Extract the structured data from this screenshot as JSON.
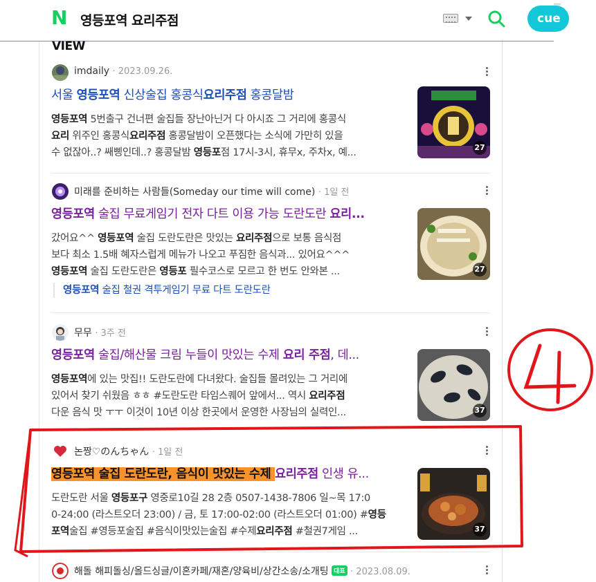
{
  "header": {
    "logo": "N",
    "query": "영등포역 요리주점",
    "cue_label": "cue"
  },
  "section_title": "VIEW",
  "posts": [
    {
      "author": "imdaily",
      "date": "2023.09.26.",
      "title_parts": [
        "서울 ",
        "영등포역",
        " 신상술집 홍콩식",
        "요리주점",
        " 홍콩달밤"
      ],
      "body_lines": [
        [
          "",
          "영등포역",
          " 5번출구 건너편 술집들 장난아닌거 다 아시죠 그 거리에 홍콩식"
        ],
        [
          "",
          "요리",
          " 위주인 홍콩식",
          "요리주점",
          " 홍콩달밤이 오픈했다는 소식에 가만히 있을"
        ],
        [
          "수 없잖아..? 쌔삥인데..? 홍콩달밤 ",
          "영등포",
          "점 17시-3시, 휴무x, 주차x, 예..."
        ]
      ],
      "thumb_count": "27"
    },
    {
      "author": "미래를 준비하는 사람들(Someday our time will come)",
      "date": "1일 전",
      "title_parts": [
        "",
        "영등포역",
        " 술집 무료게임기 전자 다트 이용 가능 도란도란 ",
        "요리..."
      ],
      "body_lines": [
        [
          "갔어요^^ ",
          "영등포역",
          " 술집 도란도란은 맛있는 ",
          "요리주점",
          "으로 보통 음식점"
        ],
        [
          "보다 최소 1.5배 혜자스럽게 메뉴가 나오고 푸짐한 음식과... 있어요^^^"
        ],
        [
          "",
          "영등포역",
          " 술집 도란도란은 ",
          "영등포",
          " 필수코스로 모르고 한 번도 안와본 ..."
        ]
      ],
      "sublink_parts": [
        "영등포역",
        " 술집 철권 격투게임기 무료 다트 도란도란"
      ],
      "thumb_count": "27"
    },
    {
      "author": "무무",
      "date": "3주 전",
      "title_parts": [
        "",
        "영등포역",
        " 술집/해산물 크림 누들이 맛있는 수제 ",
        "요리 주점",
        ", 데..."
      ],
      "body_lines": [
        [
          "",
          "영등포역",
          "에 있는 맛집!! 도란도란에 다녀왔다. 술집들 몰려있는 그 거리에"
        ],
        [
          "있어서 찾기 쉬웠음 ㅎㅎ #도란도란 타임스퀘어 앞에서... 역시 ",
          "요리주점"
        ],
        [
          "다운 음식 맛 ㅜㅜ 이것이 10년 이상 한곳에서 운영한 사장님의 실력인..."
        ]
      ],
      "thumb_count": "37"
    },
    {
      "author": "논짱♡のんちゃん",
      "date": "1일 전",
      "title_parts": [
        "",
        "영등포역 술집 도란도란, 음식이 맛있는 수제 ",
        "요리주점",
        " 인생 유..."
      ],
      "body_lines": [
        [
          "도란도란 서울 ",
          "영등포구",
          " 영중로10길 28 2층 0507-1438-7806 일~목 17:0"
        ],
        [
          "0-24:00 (라스트오더 23:00) / 금, 토 17:00-02:00 (라스트오더 01:00) #",
          "영등"
        ],
        [
          "",
          "포역",
          "술집 #영등포술집 #음식이맛있는술집 #수제",
          "요리주점",
          " #철권7게임 ..."
        ]
      ],
      "thumb_count": "37"
    },
    {
      "author": "해돌 해피돌싱/올드싱글/이혼카페/재혼/양육비/상간소송/소개팅",
      "badge": "대표",
      "date": "2023.08.09."
    }
  ],
  "annotation": {
    "label": "4",
    "color": "#e0161b"
  }
}
